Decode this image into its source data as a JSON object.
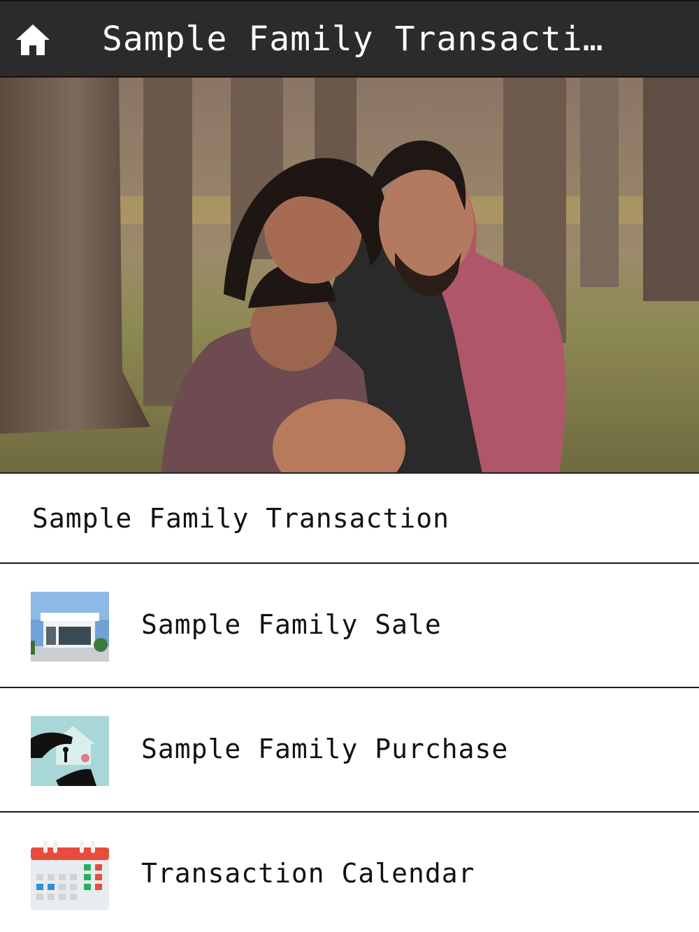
{
  "header": {
    "title": "Sample Family Transacti…",
    "home_icon": "home-icon"
  },
  "hero": {
    "image": "family-photo"
  },
  "list": {
    "section_title": "Sample Family Transaction",
    "items": [
      {
        "label": "Sample Family Sale",
        "icon": "house-photo-icon"
      },
      {
        "label": "Sample Family Purchase",
        "icon": "house-keys-icon"
      },
      {
        "label": "Transaction Calendar",
        "icon": "calendar-icon"
      }
    ]
  },
  "colors": {
    "header_bg": "#2b2b2b",
    "calendar_red": "#e84c3d",
    "calendar_blue": "#2f8fd8",
    "calendar_green": "#27ae60"
  }
}
